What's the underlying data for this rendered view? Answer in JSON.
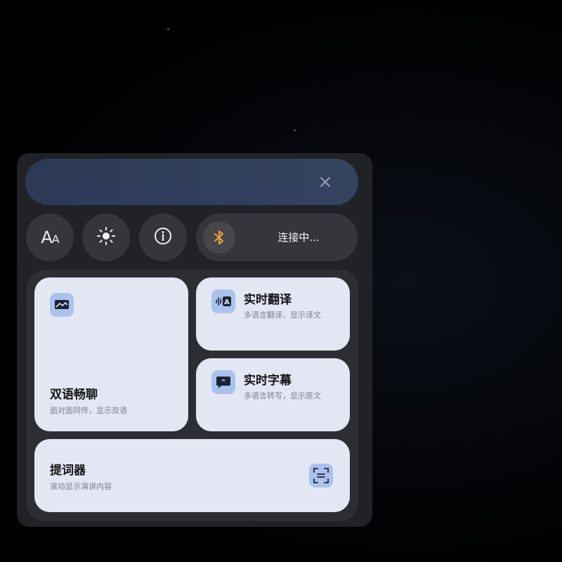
{
  "toolbar": {
    "bluetooth_status": "连接中..."
  },
  "icons": {
    "close": "close-icon",
    "font_size": "font-size-icon",
    "brightness": "brightness-icon",
    "info": "info-icon",
    "bluetooth": "bluetooth-icon"
  },
  "font_button": {
    "big": "A",
    "small": "A"
  },
  "cards": {
    "dual_chat": {
      "title": "双语畅聊",
      "subtitle": "面对面同传，显示双语"
    },
    "live_translate": {
      "title": "实时翻译",
      "subtitle": "多语言翻译，显示译文"
    },
    "live_caption": {
      "title": "实时字幕",
      "subtitle": "多语言转写，显示原文"
    },
    "teleprompter": {
      "title": "提词器",
      "subtitle": "滚动显示演讲内容"
    }
  },
  "colors": {
    "background": "#000000",
    "panel": "#212226",
    "banner": "#2c3a57",
    "card": "#e3e7f3",
    "icon_tile": "#a9c2ee",
    "bluetooth_accent": "#f0a030"
  }
}
